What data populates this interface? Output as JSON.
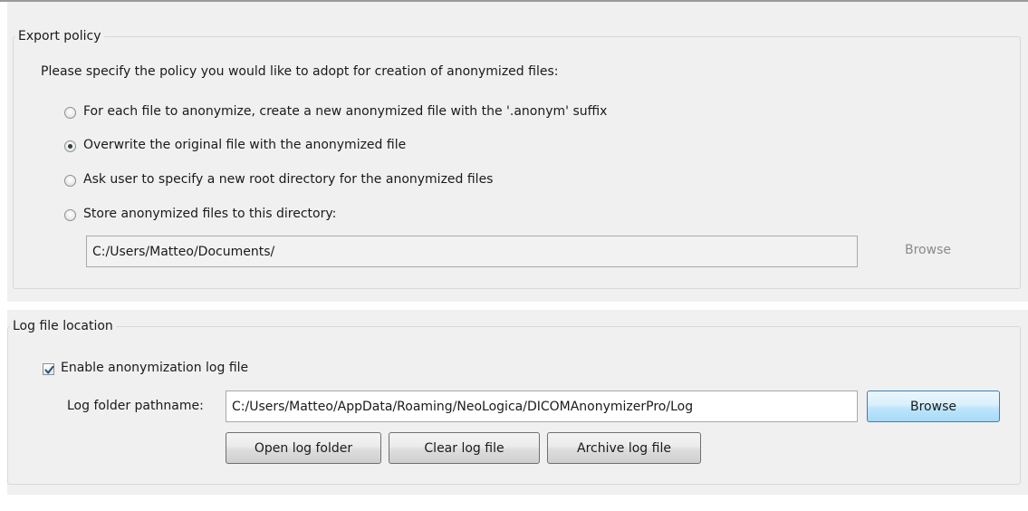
{
  "export_policy": {
    "title": "Export policy",
    "prompt": "Please specify the policy you would like to adopt for creation of anonymized files:",
    "options": [
      {
        "label": "For each file to anonymize, create a new anonymized file with the '.anonym' suffix",
        "selected": false
      },
      {
        "label": "Overwrite the original file with the anonymized file",
        "selected": true
      },
      {
        "label": "Ask user to specify a new root directory for the anonymized files",
        "selected": false
      },
      {
        "label": "Store anonymized files to this directory:",
        "selected": false
      }
    ],
    "directory_value": "C:/Users/Matteo/Documents/",
    "browse_label": "Browse"
  },
  "log_location": {
    "title": "Log file location",
    "enable_label": "Enable anonymization log file",
    "enable_checked": true,
    "folder_label": "Log folder pathname:",
    "folder_value": "C:/Users/Matteo/AppData/Roaming/NeoLogica/DICOMAnonymizerPro/Log",
    "browse_label": "Browse",
    "buttons": {
      "open": "Open log folder",
      "clear": "Clear log file",
      "archive": "Archive log file"
    }
  }
}
